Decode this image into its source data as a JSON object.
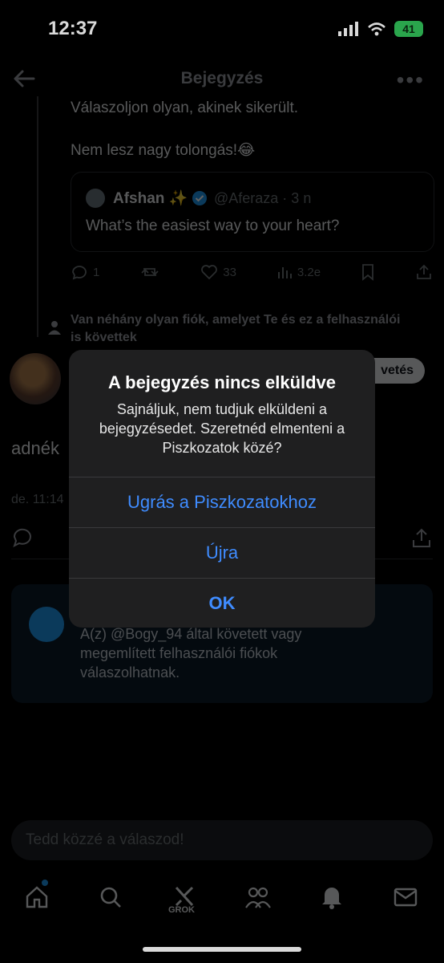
{
  "status_bar": {
    "time": "12:37",
    "battery": "41"
  },
  "header": {
    "title": "Bejegyzés"
  },
  "thread": {
    "line1": "Válaszoljon olyan, akinek sikerült.",
    "line2": "Nem lesz nagy tolongás!😂",
    "quote": {
      "name": "Afshan ✨",
      "handle": "@Aferaza · 3 n",
      "text": "What’s the easiest way to your heart?"
    },
    "actions": {
      "replies": "1",
      "likes": "33",
      "views": "3.2e"
    },
    "social_context": "Van néhány olyan fiók, amelyet Te és ez a felhasználói is követtek"
  },
  "profile": {
    "follow_label": "vetés",
    "text_partial": "adnék",
    "timestamp": "de. 11:14"
  },
  "reply_info": {
    "text": "A(z) @Bogy_94 által követett vagy megemlített felhasználói fiókok válaszolhatnak."
  },
  "compose": {
    "placeholder": "Tedd közzé a válaszod!"
  },
  "tabbar": {
    "grok_label": "GROK"
  },
  "alert": {
    "title": "A bejegyzés nincs elküldve",
    "message": "Sajnáljuk, nem tudjuk elküldeni a bejegyzésedet. Szeretnéd elmenteni a Piszkozatok közé?",
    "buttons": [
      "Ugrás a Piszkozatokhoz",
      "Újra",
      "OK"
    ]
  },
  "colors": {
    "accent": "#1d9bf0",
    "alert_button": "#3f8cff"
  }
}
